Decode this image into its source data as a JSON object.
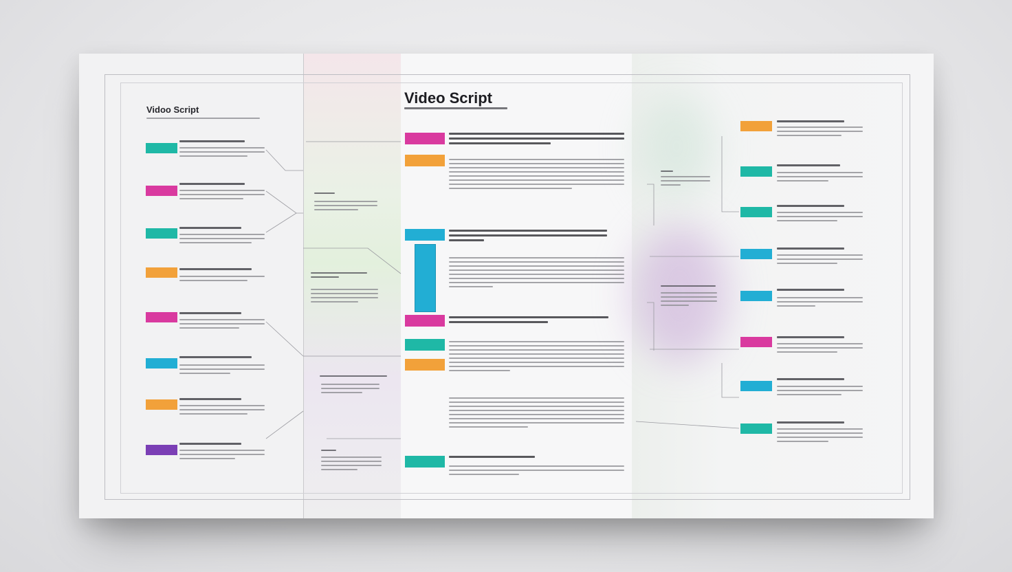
{
  "titles": {
    "main": "Video Script",
    "side": "Vidoo Script"
  },
  "colors": {
    "teal": "#1fb8a6",
    "magenta": "#d93a9f",
    "orange": "#f2a13a",
    "blue": "#22aed4",
    "purple": "#7b3fb5"
  }
}
